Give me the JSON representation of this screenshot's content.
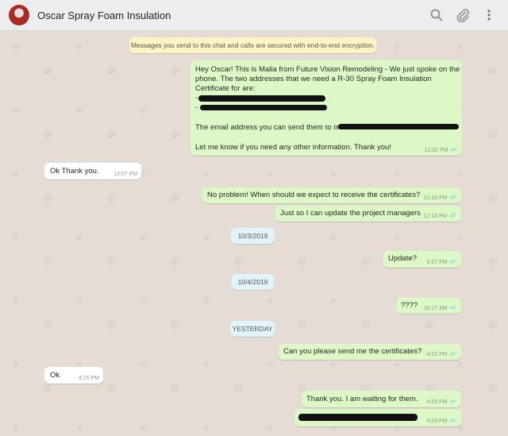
{
  "header": {
    "title": "Oscar Spray Foam Insulation"
  },
  "icons": {
    "search": "search-icon",
    "attach": "paperclip-icon",
    "menu": "more-vertical-icon"
  },
  "system_notice": "Messages you send to this chat and calls are secured with end-to-end encryption.",
  "messages": [
    {
      "lines": [
        "Hey Oscar! This is Malia from Future Vision Remodeling - We just spoke on the",
        "phone. The two addresses that we need a R-30 Spray Foam Insulation",
        "Certificate for are:",
        "-",
        "-",
        "The email address you can send them to is:",
        "Let me know if you need any other information. Thank you!"
      ],
      "time": "12:02 PM"
    },
    {
      "text": "Ok Thank you.",
      "time": "12:07 PM"
    },
    {
      "text": "No problem! When should we expect to receive the certificates?",
      "time": "12:10 PM"
    },
    {
      "text": "Just so I can update the project managers",
      "time": "12:10 PM"
    },
    {
      "text": "Update?",
      "time": "5:07 PM"
    },
    {
      "text": "????",
      "time": "10:17 AM"
    },
    {
      "text": "Can you please send me the certificates?",
      "time": "4:22 PM"
    },
    {
      "text": "Ok",
      "time": "4:25 PM"
    },
    {
      "text": "Thank you. I am waiting for them.",
      "time": "4:29 PM"
    },
    {
      "text": "",
      "time": "4:29 PM"
    }
  ],
  "dates": [
    "10/3/2019",
    "10/4/2019",
    "YESTERDAY"
  ],
  "colors": {
    "outgoing": "#dcf8c6",
    "incoming": "#ffffff",
    "read_ticks": "#4fc3f7",
    "background": "#e5ddd5"
  }
}
